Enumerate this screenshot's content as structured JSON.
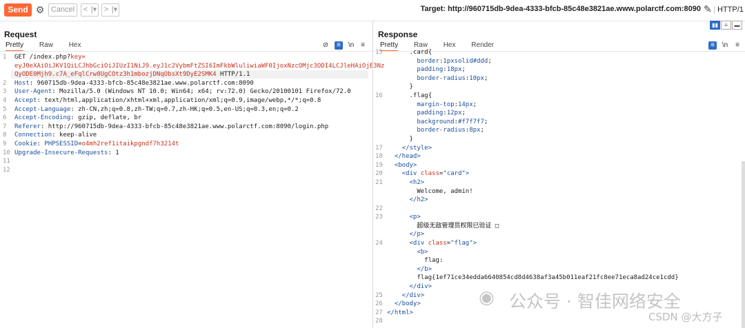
{
  "toolbar": {
    "send_label": "Send",
    "cancel_label": "Cancel",
    "back_label": "<",
    "back_dd": "|▾",
    "fwd_label": ">",
    "fwd_dd": "|▾",
    "target_text": "Target: http://960715db-9dea-4333-bfcb-85c48e3821ae.www.polarctf.com:8090",
    "http_version": "HTTP/1"
  },
  "request": {
    "title": "Request",
    "tabs": [
      "Pretty",
      "Raw",
      "Hex"
    ],
    "nl_label": "\\n",
    "lines": [
      {
        "n": "1",
        "parts": [
          [
            "hv",
            "GET /index.php?"
          ],
          [
            "kw",
            "key="
          ]
        ]
      },
      {
        "n": "",
        "parts": [
          [
            "kw",
            "eyJ0eXAiOiJKV1QiLCJhbGciOiJIUzI1NiJ9.eyJ1c2VybmFtZSI6ImFkbWluliwiaWF0IjoxNzcOMjc3ODI4LCJleHAiOjE3Nz"
          ]
        ]
      },
      {
        "n": "",
        "parts": [
          [
            "kw",
            "QyODE0Mjh9.c7A_eFqlCrw8UgCOtz3h1mbozjDNqObsXt9DyE2SMK4"
          ],
          [
            "hv",
            " HTTP/1.1"
          ]
        ]
      },
      {
        "n": "2",
        "parts": [
          [
            "blue",
            "Host"
          ],
          [
            "hv",
            ": 960715db-9dea-4333-bfcb-85c48e3821ae.www.polarctf.com:8090"
          ]
        ]
      },
      {
        "n": "3",
        "parts": [
          [
            "blue",
            "User-Agent"
          ],
          [
            "hv",
            ": Mozilla/5.0 (Windows NT 10.0; Win64; x64; rv:72.0) Gecko/20100101 Firefox/72.0"
          ]
        ]
      },
      {
        "n": "4",
        "parts": [
          [
            "blue",
            "Accept"
          ],
          [
            "hv",
            ": text/html,application/xhtml+xml,application/xml;q=0.9,image/webp,*/*;q=0.8"
          ]
        ]
      },
      {
        "n": "5",
        "parts": [
          [
            "blue",
            "Accept-Language"
          ],
          [
            "hv",
            ": zh-CN,zh;q=0.8,zh-TW;q=0.7,zh-HK;q=0.5,en-US;q=0.3,en;q=0.2"
          ]
        ]
      },
      {
        "n": "6",
        "parts": [
          [
            "blue",
            "Accept-Encoding"
          ],
          [
            "hv",
            ": gzip, deflate, br"
          ]
        ]
      },
      {
        "n": "7",
        "parts": [
          [
            "blue",
            "Referer"
          ],
          [
            "hv",
            ": http://960715db-9dea-4333-bfcb-85c48e3821ae.www.polarctf.com:8090/login.php"
          ]
        ]
      },
      {
        "n": "8",
        "parts": [
          [
            "blue",
            "Connection"
          ],
          [
            "hv",
            ": keep-alive"
          ]
        ]
      },
      {
        "n": "9",
        "parts": [
          [
            "blue",
            "Cookie"
          ],
          [
            "hv",
            ": "
          ],
          [
            "blue",
            "PHPSESSID"
          ],
          [
            "hv",
            "="
          ],
          [
            "kw",
            "o4mh2ref1itaikpgndf7h3214t"
          ]
        ]
      },
      {
        "n": "10",
        "parts": [
          [
            "blue",
            "Upgrade-Insecure-Requests"
          ],
          [
            "hv",
            ": 1"
          ]
        ]
      },
      {
        "n": "11",
        "parts": []
      },
      {
        "n": "12",
        "parts": []
      }
    ]
  },
  "response": {
    "title": "Response",
    "tabs": [
      "Pretty",
      "Raw",
      "Hex",
      "Render"
    ],
    "nl_label": "\\n",
    "lines": [
      {
        "n": "15",
        "parts": [
          [
            "hv",
            "      .card{"
          ]
        ]
      },
      {
        "n": "",
        "parts": [
          [
            "blue",
            "        border"
          ],
          [
            "hv",
            ":"
          ],
          [
            "blue",
            "1pxsolid#ddd"
          ],
          [
            "hv",
            ";"
          ]
        ]
      },
      {
        "n": "",
        "parts": [
          [
            "blue",
            "        padding"
          ],
          [
            "hv",
            ":"
          ],
          [
            "blue",
            "18px"
          ],
          [
            "hv",
            ";"
          ]
        ]
      },
      {
        "n": "",
        "parts": [
          [
            "blue",
            "        border-radius"
          ],
          [
            "hv",
            ":"
          ],
          [
            "blue",
            "10px"
          ],
          [
            "hv",
            ";"
          ]
        ]
      },
      {
        "n": "",
        "parts": [
          [
            "hv",
            "      }"
          ]
        ]
      },
      {
        "n": "16",
        "parts": [
          [
            "hv",
            "      .flag{"
          ]
        ]
      },
      {
        "n": "",
        "parts": [
          [
            "blue",
            "        margin-top"
          ],
          [
            "hv",
            ":"
          ],
          [
            "blue",
            "14px"
          ],
          [
            "hv",
            ";"
          ]
        ]
      },
      {
        "n": "",
        "parts": [
          [
            "blue",
            "        padding"
          ],
          [
            "hv",
            ":"
          ],
          [
            "blue",
            "12px"
          ],
          [
            "hv",
            ";"
          ]
        ]
      },
      {
        "n": "",
        "parts": [
          [
            "blue",
            "        background"
          ],
          [
            "hv",
            ":"
          ],
          [
            "blue",
            "#f7f7f7"
          ],
          [
            "hv",
            ";"
          ]
        ]
      },
      {
        "n": "",
        "parts": [
          [
            "blue",
            "        border-radius"
          ],
          [
            "hv",
            ":"
          ],
          [
            "blue",
            "8px"
          ],
          [
            "hv",
            ";"
          ]
        ]
      },
      {
        "n": "",
        "parts": [
          [
            "hv",
            "      }"
          ]
        ]
      },
      {
        "n": "17",
        "parts": [
          [
            "tag",
            "    </style>"
          ]
        ]
      },
      {
        "n": "18",
        "parts": [
          [
            "tag",
            "  </head>"
          ]
        ]
      },
      {
        "n": "19",
        "parts": [
          [
            "tag",
            "  <body>"
          ]
        ]
      },
      {
        "n": "20",
        "parts": [
          [
            "tag",
            "    <div "
          ],
          [
            "kw",
            "class"
          ],
          [
            "hv",
            "="
          ],
          [
            "tag",
            "\"card\""
          ],
          [
            "tag",
            ">"
          ]
        ]
      },
      {
        "n": "21",
        "parts": [
          [
            "tag",
            "      <h2>"
          ]
        ]
      },
      {
        "n": "",
        "parts": [
          [
            "hv",
            "        Welcome, admin!"
          ]
        ]
      },
      {
        "n": "",
        "parts": [
          [
            "tag",
            "      </h2>"
          ]
        ]
      },
      {
        "n": "22",
        "parts": []
      },
      {
        "n": "23",
        "parts": [
          [
            "tag",
            "      <p>"
          ]
        ]
      },
      {
        "n": "",
        "parts": [
          [
            "hv",
            "        超级无敌管理员权限已验证 □"
          ]
        ]
      },
      {
        "n": "",
        "parts": [
          [
            "tag",
            "      </p>"
          ]
        ]
      },
      {
        "n": "24",
        "parts": [
          [
            "tag",
            "      <div "
          ],
          [
            "kw",
            "class"
          ],
          [
            "hv",
            "="
          ],
          [
            "tag",
            "\"flag\""
          ],
          [
            "tag",
            ">"
          ]
        ]
      },
      {
        "n": "",
        "parts": [
          [
            "tag",
            "        <b>"
          ]
        ]
      },
      {
        "n": "",
        "parts": [
          [
            "hv",
            "          flag:"
          ]
        ]
      },
      {
        "n": "",
        "parts": [
          [
            "tag",
            "        </b>"
          ]
        ]
      },
      {
        "n": "",
        "parts": [
          [
            "hv",
            "        flag{1ef71ce34edda6640854cd8d4638af3a45b011eaf21fc8ee71eca8ad24ce1cdd}"
          ]
        ]
      },
      {
        "n": "",
        "parts": [
          [
            "tag",
            "      </div>"
          ]
        ]
      },
      {
        "n": "25",
        "parts": [
          [
            "tag",
            "    </div>"
          ]
        ]
      },
      {
        "n": "26",
        "parts": [
          [
            "tag",
            "  </body>"
          ]
        ]
      },
      {
        "n": "27",
        "parts": [
          [
            "tag",
            "</html>"
          ]
        ]
      },
      {
        "n": "28",
        "parts": []
      }
    ]
  },
  "watermark": {
    "wechat_text": "公众号 · 智佳网络安全",
    "csdn_text": "CSDN @大方子"
  }
}
